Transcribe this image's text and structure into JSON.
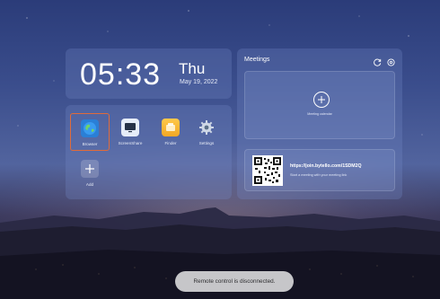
{
  "clock": {
    "time": "05:33",
    "day": "Thu",
    "date": "May 19, 2022"
  },
  "apps": [
    {
      "label": "Browser",
      "icon": "browser-globe-icon",
      "selected": true
    },
    {
      "label": "ScreenShare",
      "icon": "screen-share-icon"
    },
    {
      "label": "Finder",
      "icon": "finder-folder-icon"
    },
    {
      "label": "Settings",
      "icon": "settings-gear-icon"
    },
    {
      "label": "Add",
      "icon": "plus-icon"
    }
  ],
  "meetings": {
    "title": "Meetings",
    "refresh_icon": "refresh-icon",
    "settings_icon": "gear-icon",
    "calendar_label": "Meeting calendar",
    "link_url": "https://join.bytello.com/1SDM2Q",
    "link_hint": "Start a meeting with your meeting link"
  },
  "toast": {
    "message": "Remote control is disconnected."
  },
  "colors": {
    "selection_border": "#e06b3b",
    "browser_blue": "#2a7fd6",
    "finder_yellow": "#f3a826"
  }
}
